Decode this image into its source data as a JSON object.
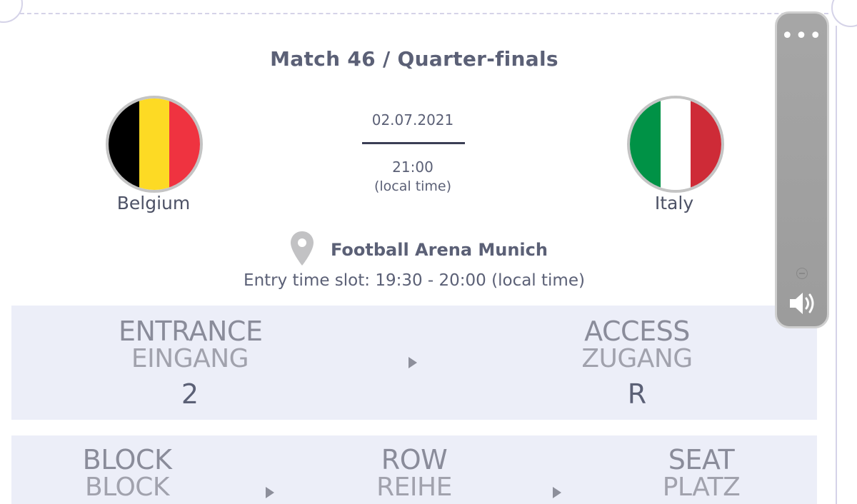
{
  "match": {
    "title": "Match 46 / Quarter-finals",
    "date": "02.07.2021",
    "time": "21:00",
    "time_note": "(local time)"
  },
  "home_team": {
    "name": "Belgium",
    "flag_icon": "belgium-flag-icon",
    "flag_colors": [
      "#000000",
      "#fdda24",
      "#ef3340"
    ]
  },
  "away_team": {
    "name": "Italy",
    "flag_icon": "italy-flag-icon",
    "flag_colors": [
      "#009246",
      "#ffffff",
      "#ce2b37"
    ]
  },
  "venue": {
    "icon": "location-pin-icon",
    "name": "Football Arena Munich",
    "entry_slot": "Entry time slot: 19:30 - 20:00 (local time)"
  },
  "entrance": {
    "label_en": "ENTRANCE",
    "label_de": "EINGANG",
    "value": "2"
  },
  "access": {
    "label_en": "ACCESS",
    "label_de": "ZUGANG",
    "value": "R"
  },
  "block": {
    "label_en": "BLOCK",
    "label_de": "BLOCK"
  },
  "row": {
    "label_en": "ROW",
    "label_de": "REIHE"
  },
  "seat": {
    "label_en": "SEAT",
    "label_de": "PLATZ"
  },
  "widget": {
    "more_icon": "more-dots-icon",
    "zoom_icon": "zoom-out-icon",
    "speaker_icon": "speaker-icon",
    "dots": "•••"
  },
  "colors": {
    "panel_bg": "#eceef8",
    "text": "#5b6076",
    "muted": "#a1a2ad"
  }
}
